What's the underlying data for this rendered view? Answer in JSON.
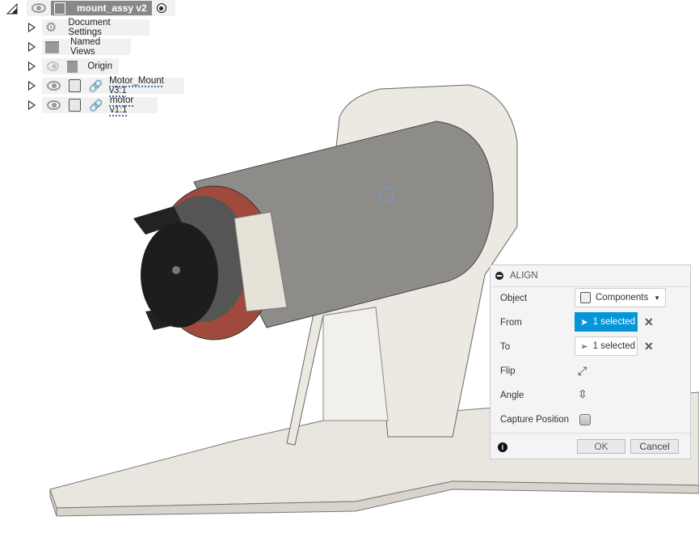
{
  "browser": {
    "root": {
      "label": "mount_assy v2",
      "icons": [
        "collapse-triangle",
        "eye-icon",
        "assembly-icon",
        "activate-radio-icon"
      ]
    },
    "items": [
      {
        "label": "Document Settings",
        "icon": "gear-icon"
      },
      {
        "label": "Named Views",
        "icon": "folder-icon"
      },
      {
        "label": "Origin",
        "icon": "folder-icon",
        "hidden": true
      },
      {
        "label": "Motor_Mount v3:1",
        "icon": "component-icon",
        "linked": true
      },
      {
        "label": "motor v1:1",
        "icon": "component-icon",
        "linked": true
      }
    ]
  },
  "align": {
    "title": "ALIGN",
    "object_label": "Object",
    "object_value": "Components",
    "from_label": "From",
    "from_value": "1 selected",
    "to_label": "To",
    "to_value": "1 selected",
    "flip_label": "Flip",
    "angle_label": "Angle",
    "capture_label": "Capture Position",
    "capture_checked": false,
    "ok": "OK",
    "cancel": "Cancel",
    "accent": "#0696d7"
  },
  "annotation": {
    "color": "#e31b1b"
  }
}
